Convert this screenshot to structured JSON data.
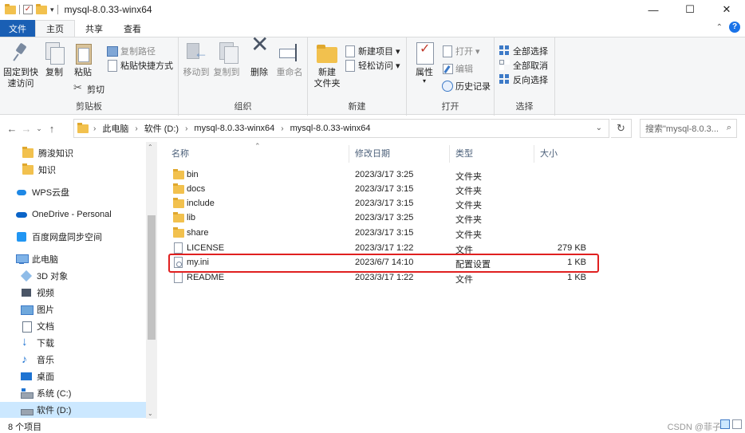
{
  "window": {
    "title": "mysql-8.0.33-winx64",
    "controls": {
      "minimize": "—",
      "maximize": "☐",
      "close": "✕"
    }
  },
  "ribbon_tabs": {
    "file": "文件",
    "items": [
      "主页",
      "共享",
      "查看"
    ],
    "active": "主页"
  },
  "ribbon": {
    "clipboard": {
      "label": "剪贴板",
      "pin": "固定到快\n速访问",
      "copy": "复制",
      "paste": "粘贴",
      "copy_path": "复制路径",
      "paste_shortcut": "粘贴快捷方式",
      "cut": "剪切"
    },
    "organize": {
      "label": "组织",
      "move_to": "移动到",
      "copy_to": "复制到",
      "delete": "删除",
      "rename": "重命名"
    },
    "new": {
      "label": "新建",
      "new_folder": "新建\n文件夹",
      "new_item": "新建项目 ▾",
      "easy_access": "轻松访问 ▾"
    },
    "open": {
      "label": "打开",
      "properties": "属性",
      "open": "打开 ▾",
      "edit": "编辑",
      "history": "历史记录"
    },
    "select": {
      "label": "选择",
      "select_all": "全部选择",
      "select_none": "全部取消",
      "invert": "反向选择"
    }
  },
  "address": {
    "crumbs": [
      "此电脑",
      "软件 (D:)",
      "mysql-8.0.33-winx64",
      "mysql-8.0.33-winx64"
    ],
    "search_placeholder": "搜索\"mysql-8.0.3..."
  },
  "nav_pane": {
    "items": [
      {
        "label": "腾浚知识",
        "icon": "folder-icon"
      },
      {
        "label": "知识",
        "icon": "folder-icon"
      },
      {
        "label": "WPS云盘",
        "icon": "cloud-icon"
      },
      {
        "label": "OneDrive - Personal",
        "icon": "onedrive-icon"
      },
      {
        "label": "百度网盘同步空间",
        "icon": "baidu-icon"
      },
      {
        "label": "此电脑",
        "icon": "pc-icon"
      },
      {
        "label": "3D 对象",
        "icon": "3d-objects-icon"
      },
      {
        "label": "视频",
        "icon": "video-icon"
      },
      {
        "label": "图片",
        "icon": "pictures-icon"
      },
      {
        "label": "文档",
        "icon": "documents-icon"
      },
      {
        "label": "下载",
        "icon": "download-icon"
      },
      {
        "label": "音乐",
        "icon": "music-icon"
      },
      {
        "label": "桌面",
        "icon": "desktop-icon"
      },
      {
        "label": "系统 (C:)",
        "icon": "drive-icon"
      },
      {
        "label": "软件 (D:)",
        "icon": "drive-icon"
      }
    ],
    "selected": "软件 (D:)"
  },
  "file_list": {
    "headers": {
      "name": "名称",
      "date": "修改日期",
      "type": "类型",
      "size": "大小"
    },
    "rows": [
      {
        "name": "bin",
        "date": "2023/3/17 3:25",
        "type": "文件夹",
        "size": "",
        "kind": "folder"
      },
      {
        "name": "docs",
        "date": "2023/3/17 3:15",
        "type": "文件夹",
        "size": "",
        "kind": "folder"
      },
      {
        "name": "include",
        "date": "2023/3/17 3:15",
        "type": "文件夹",
        "size": "",
        "kind": "folder"
      },
      {
        "name": "lib",
        "date": "2023/3/17 3:25",
        "type": "文件夹",
        "size": "",
        "kind": "folder"
      },
      {
        "name": "share",
        "date": "2023/3/17 3:15",
        "type": "文件夹",
        "size": "",
        "kind": "folder"
      },
      {
        "name": "LICENSE",
        "date": "2023/3/17 1:22",
        "type": "文件",
        "size": "279 KB",
        "kind": "file"
      },
      {
        "name": "my.ini",
        "date": "2023/6/7 14:10",
        "type": "配置设置",
        "size": "1 KB",
        "kind": "ini"
      },
      {
        "name": "README",
        "date": "2023/3/17 1:22",
        "type": "文件",
        "size": "1 KB",
        "kind": "file"
      }
    ],
    "highlighted_row": "my.ini",
    "highlight_color": "#e02020"
  },
  "status": {
    "count": "8 个项目",
    "watermark": "CSDN @菲子"
  },
  "colors": {
    "file_tab": "#1a5fb4",
    "selection": "#cce8ff",
    "folder": "#f2c14e"
  }
}
